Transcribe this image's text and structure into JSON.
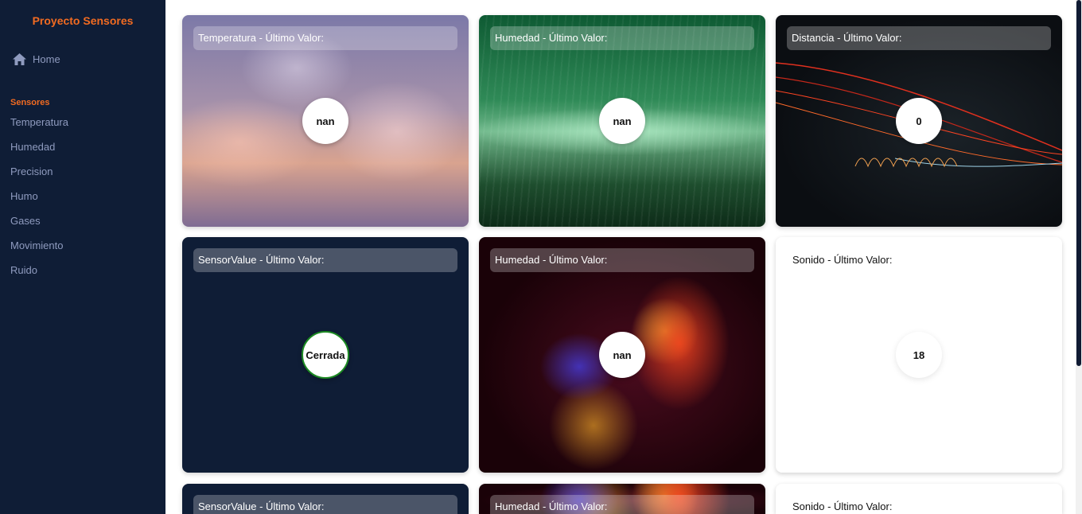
{
  "sidebar": {
    "brand": "Proyecto Sensores",
    "home_label": "Home",
    "section_label": "Sensores",
    "items": [
      {
        "label": "Temperatura"
      },
      {
        "label": "Humedad"
      },
      {
        "label": "Precision"
      },
      {
        "label": "Humo"
      },
      {
        "label": "Gases"
      },
      {
        "label": "Movimiento"
      },
      {
        "label": "Ruido"
      }
    ]
  },
  "cards": [
    {
      "title": "Temperatura - Último Valor:",
      "value": "nan"
    },
    {
      "title": "Humedad - Último Valor:",
      "value": "nan"
    },
    {
      "title": "Distancia - Último Valor:",
      "value": "0"
    },
    {
      "title": "SensorValue - Último Valor:",
      "value": "Cerrada"
    },
    {
      "title": "Humedad - Último Valor:",
      "value": "nan"
    },
    {
      "title": "Sonido - Último Valor:",
      "value": "18"
    },
    {
      "title": "SensorValue - Último Valor:",
      "value": ""
    },
    {
      "title": "Humedad - Último Valor:",
      "value": ""
    },
    {
      "title": "Sonido - Último Valor:",
      "value": ""
    }
  ],
  "colors": {
    "sidebar_bg": "#0f1d36",
    "accent": "#f26b21",
    "status_green": "#1c8a22"
  },
  "icons": {
    "home": "home-icon"
  }
}
